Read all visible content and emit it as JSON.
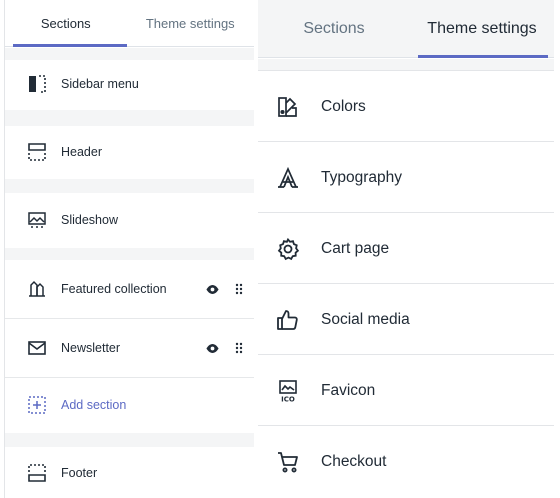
{
  "left_panel": {
    "tabs": {
      "sections": "Sections",
      "theme_settings": "Theme settings",
      "active": "sections"
    },
    "sections": [
      {
        "label": "Sidebar menu",
        "icon": "sidebar-icon"
      },
      {
        "label": "Header",
        "icon": "header-icon"
      },
      {
        "label": "Slideshow",
        "icon": "slideshow-icon"
      },
      {
        "label": "Featured collection",
        "icon": "collection-icon",
        "visible_toggle": true,
        "draggable": true
      },
      {
        "label": "Newsletter",
        "icon": "envelope-icon",
        "visible_toggle": true,
        "draggable": true
      },
      {
        "label": "Add section",
        "icon": "add-section-icon",
        "link": true
      },
      {
        "label": "Footer",
        "icon": "footer-icon"
      }
    ]
  },
  "right_panel": {
    "tabs": {
      "sections": "Sections",
      "theme_settings": "Theme settings",
      "active": "theme_settings"
    },
    "settings": [
      {
        "label": "Colors",
        "icon": "palette-icon"
      },
      {
        "label": "Typography",
        "icon": "typography-icon"
      },
      {
        "label": "Cart page",
        "icon": "gear-icon"
      },
      {
        "label": "Social media",
        "icon": "thumbs-up-icon"
      },
      {
        "label": "Favicon",
        "icon": "favicon-icon"
      },
      {
        "label": "Checkout",
        "icon": "cart-icon"
      }
    ]
  },
  "colors": {
    "accent": "#5c6ac4",
    "text": "#212b36",
    "muted": "#637381",
    "icon": "#212b36"
  }
}
